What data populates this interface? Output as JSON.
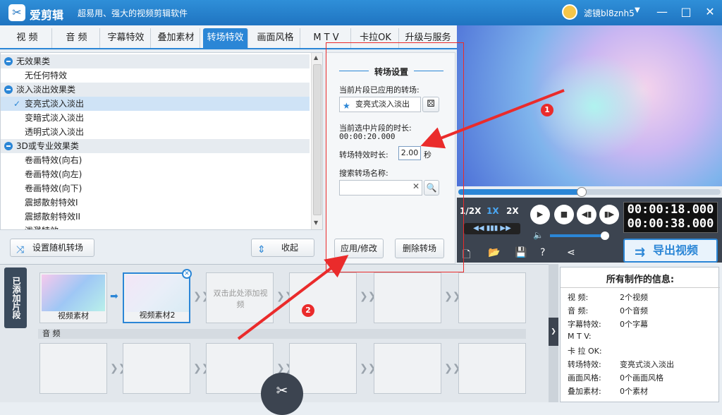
{
  "app": {
    "name": "爱剪辑",
    "slogan": "超易用、强大的视频剪辑软件",
    "user": "滤镜bl8znh5"
  },
  "tabs": [
    "视 频",
    "音 频",
    "字幕特效",
    "叠加素材",
    "转场特效",
    "画面风格",
    "M T V",
    "卡拉OK",
    "升级与服务"
  ],
  "effects": {
    "categories": [
      {
        "name": "无效果类",
        "items": [
          "无任何特效"
        ]
      },
      {
        "name": "淡入淡出效果类",
        "items": [
          "变亮式淡入淡出",
          "变暗式淡入淡出",
          "透明式淡入淡出"
        ]
      },
      {
        "name": "3D或专业效果类",
        "items": [
          "卷画特效(向右)",
          "卷画特效(向左)",
          "卷画特效(向下)",
          "震撼散射特效I",
          "震撼散射特效II",
          "泼溅特效"
        ]
      }
    ],
    "selected": "变亮式淡入淡出",
    "random_btn": "设置随机转场",
    "collapse_btn": "收起"
  },
  "settings": {
    "title": "转场设置",
    "applied_label": "当前片段已应用的转场:",
    "applied_value": "变亮式淡入淡出",
    "clip_duration_label": "当前选中片段的时长:",
    "clip_duration": "00:00:20.000",
    "effect_duration_label": "转场特效时长:",
    "effect_duration": "2.00",
    "seconds_unit": "秒",
    "search_label": "搜索转场名称:",
    "apply_btn": "应用/修改",
    "delete_btn": "删除转场"
  },
  "player": {
    "speeds": [
      "1/2X",
      "1X",
      "2X"
    ],
    "active_speed": "1X",
    "time_current": "00:00:18.000",
    "time_total": "00:00:38.000",
    "seek_progress": 0.47,
    "export_btn": "导出视频"
  },
  "timeline": {
    "added_label": "已添加片段",
    "clips": [
      "视频素材",
      "视频素材2"
    ],
    "placeholder": "双击此处添加视频",
    "audio_label": "音 频"
  },
  "info": {
    "title": "所有制作的信息:",
    "rows": [
      {
        "k": "视    频:",
        "v": "2个视频"
      },
      {
        "k": "音    频:",
        "v": "0个音频"
      },
      {
        "k": "字幕特效:",
        "v": "0个字幕"
      },
      {
        "k": "M  T  V:",
        "v": ""
      },
      {
        "k": "卡 拉 OK:",
        "v": ""
      },
      {
        "k": "转场特效:",
        "v": "变亮式淡入淡出"
      },
      {
        "k": "画面风格:",
        "v": "0个画面风格"
      },
      {
        "k": "叠加素材:",
        "v": "0个素材"
      }
    ]
  },
  "annotations": [
    "1",
    "2"
  ],
  "colors": {
    "accent": "#2b86d6",
    "annotation": "#ea2b2b"
  }
}
